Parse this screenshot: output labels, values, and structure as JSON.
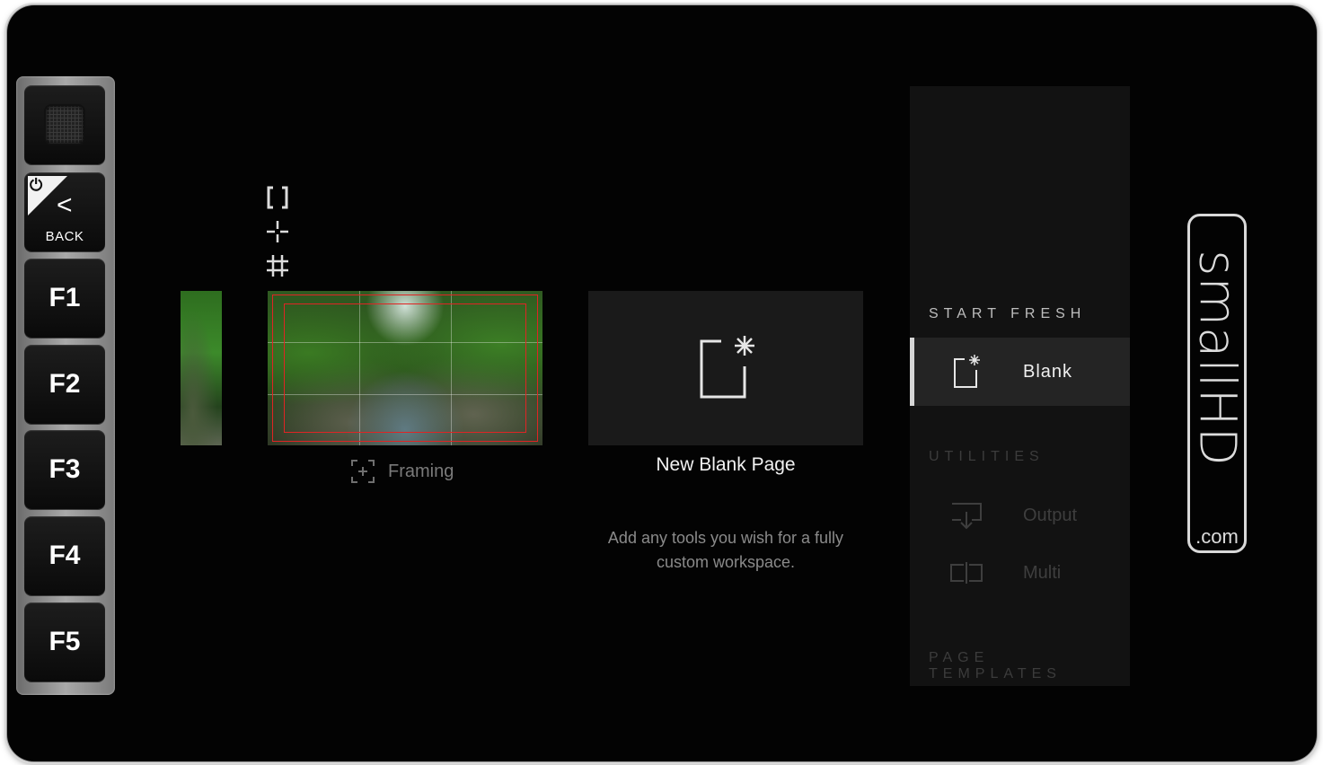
{
  "hardware_buttons": {
    "back_label": "BACK",
    "f1": "F1",
    "f2": "F2",
    "f3": "F3",
    "f4": "F4",
    "f5": "F5"
  },
  "overlay_icons": [
    "bracket-icon",
    "crosshair-icon",
    "grid-icon"
  ],
  "pages": {
    "framing_label": "Framing",
    "new_blank_title": "New Blank Page",
    "new_blank_description": "Add any tools you wish for a fully custom workspace."
  },
  "menu": {
    "start_fresh_title": "START FRESH",
    "blank_label": "Blank",
    "utilities_title": "UTILITIES",
    "output_label": "Output",
    "multi_label": "Multi",
    "page_templates_title": "PAGE TEMPLATES"
  },
  "brand": {
    "name": "smallHD",
    "domain": ".com"
  },
  "colors": {
    "background": "#030303",
    "frame_guide": "#e02424",
    "selected_item": "#242424",
    "panel": "#121212"
  }
}
